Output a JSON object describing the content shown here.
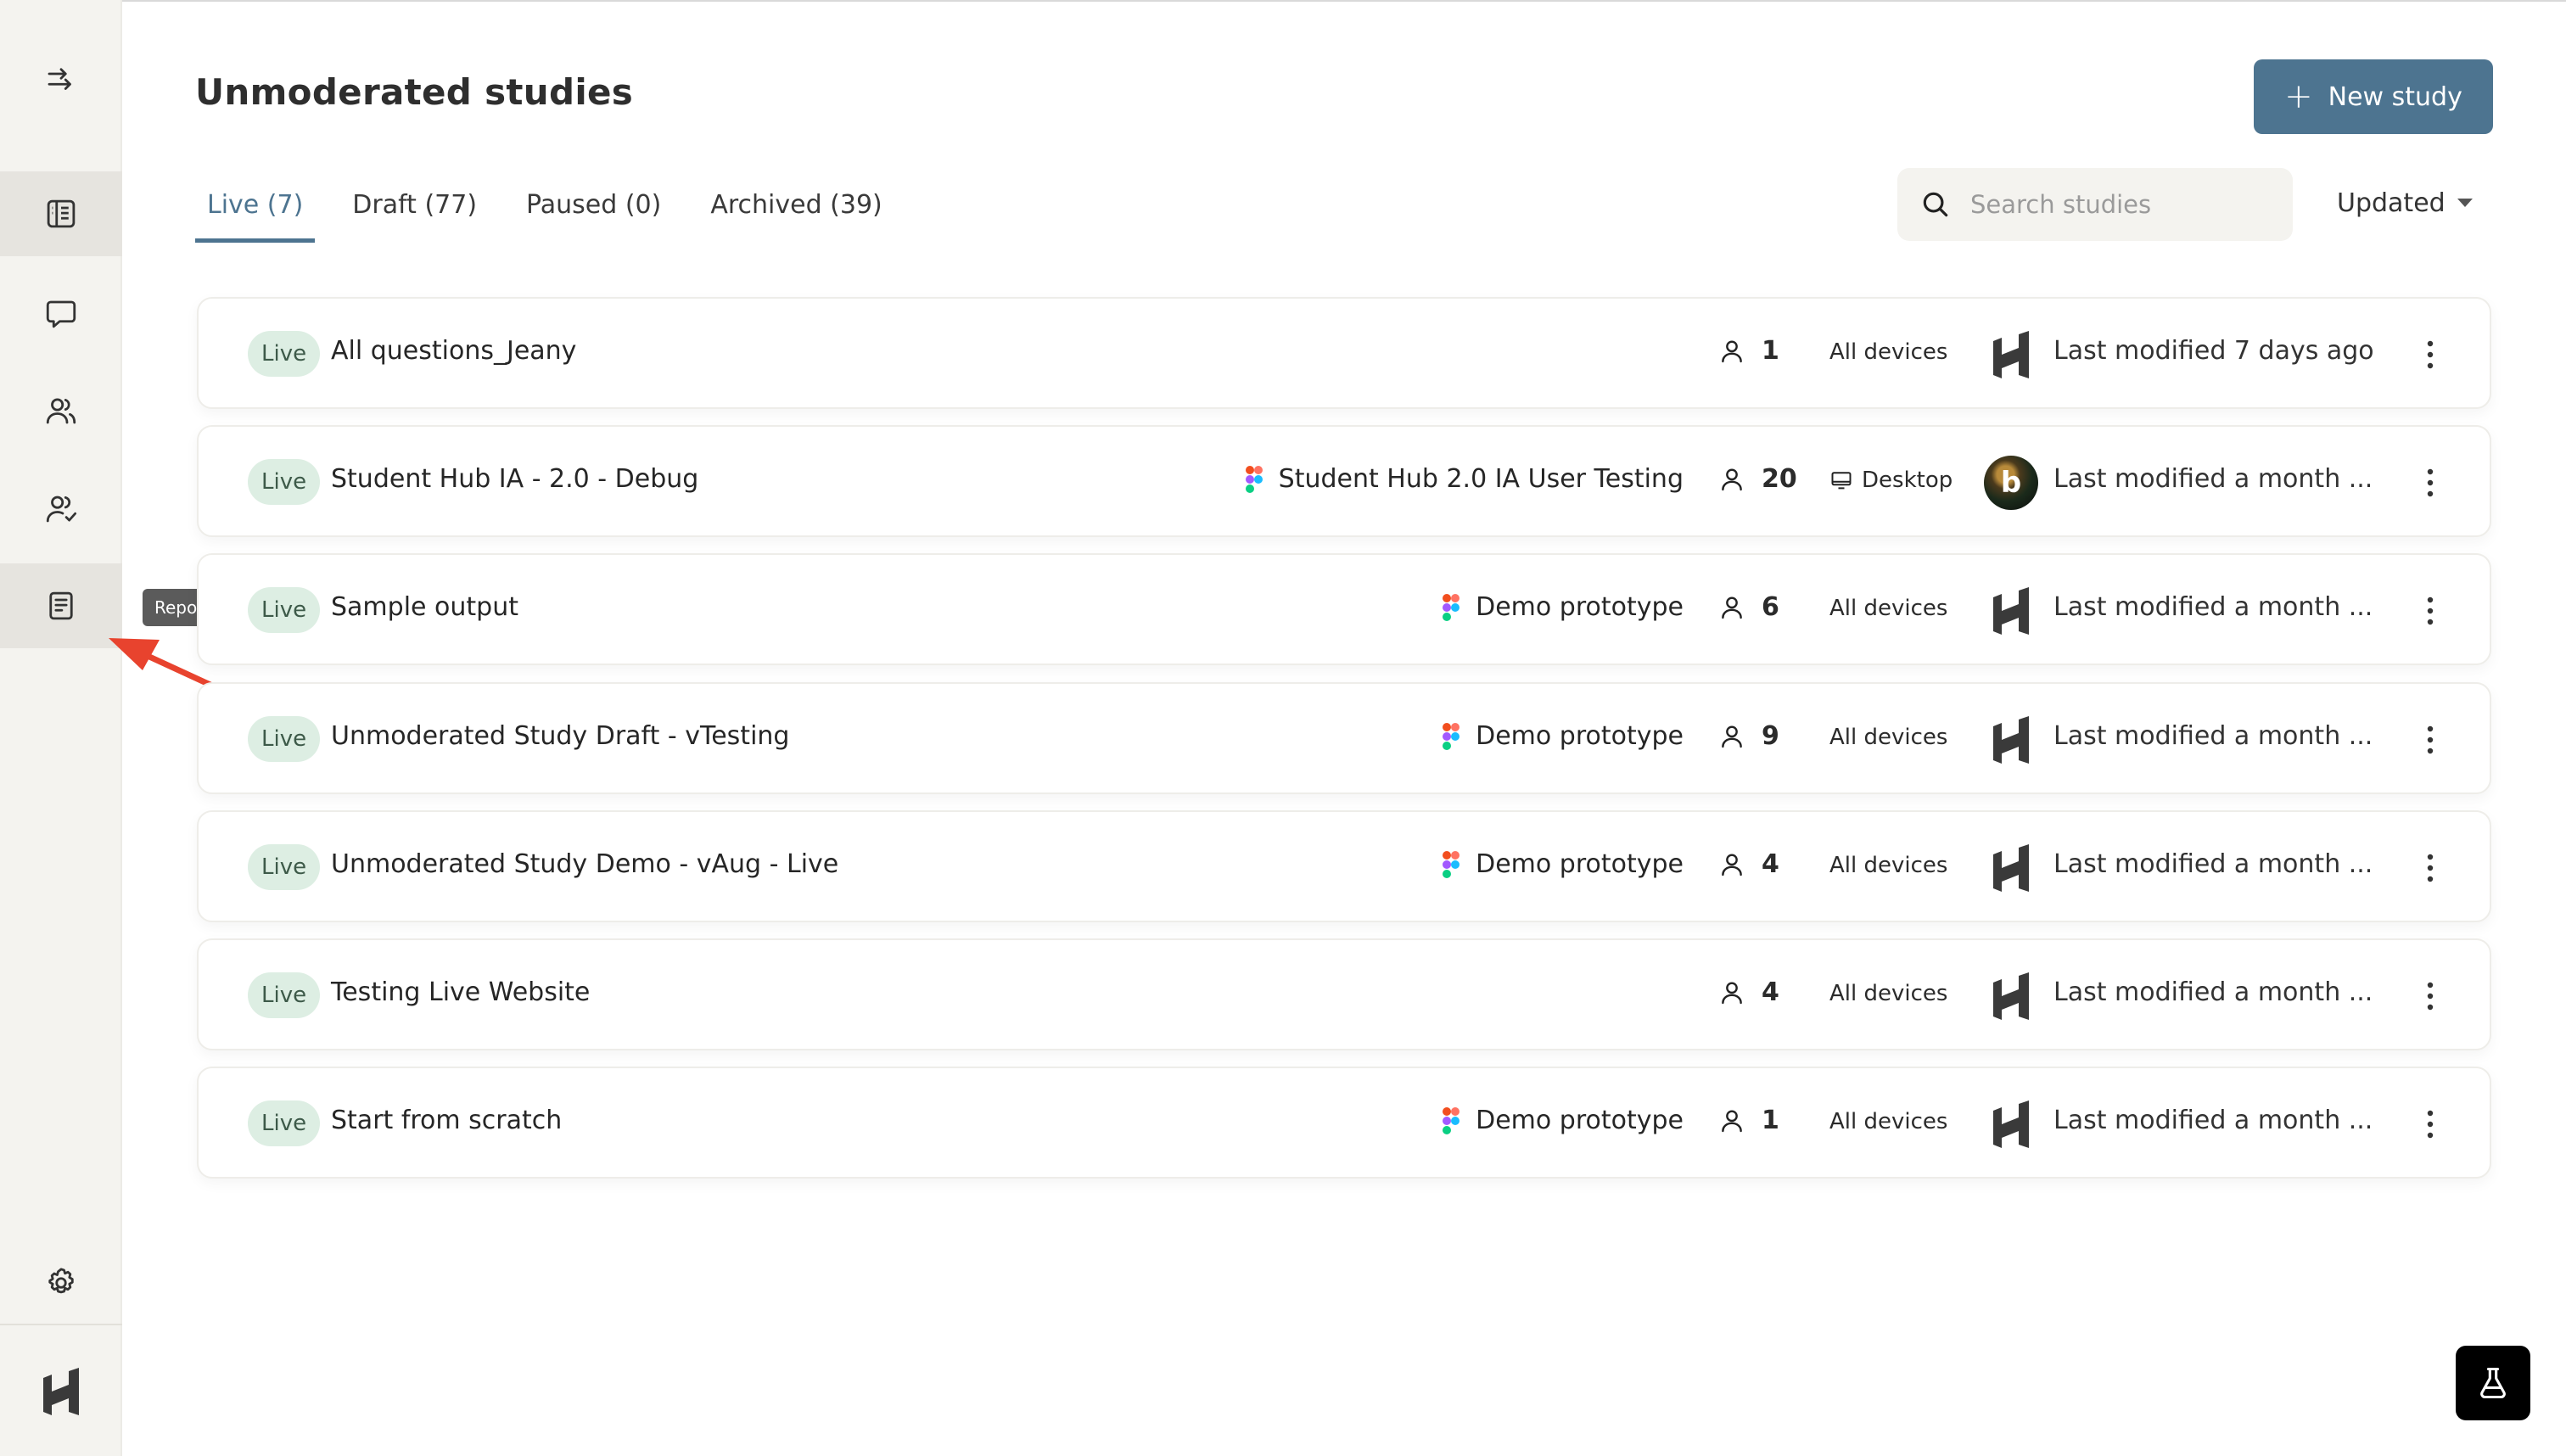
{
  "sidebar": {
    "collapse_icon": "arrow-right-to-line-icon",
    "items": [
      {
        "name": "studies",
        "icon": "book-open-icon",
        "active": true
      },
      {
        "name": "interviews",
        "icon": "chat-bubble-icon",
        "active": false
      },
      {
        "name": "participants",
        "icon": "users-icon",
        "active": false
      },
      {
        "name": "panel",
        "icon": "user-check-icon",
        "active": false
      },
      {
        "name": "reports",
        "icon": "document-icon",
        "active": false
      }
    ],
    "settings_icon": "gear-icon",
    "logo_icon": "brand-logo-icon",
    "tooltip": "Reports"
  },
  "header": {
    "title": "Unmoderated studies",
    "new_study_label": "New study"
  },
  "tabs": [
    {
      "label": "Live (7)",
      "active": true
    },
    {
      "label": "Draft (77)",
      "active": false
    },
    {
      "label": "Paused (0)",
      "active": false
    },
    {
      "label": "Archived (39)",
      "active": false
    }
  ],
  "search": {
    "placeholder": "Search studies",
    "value": ""
  },
  "sort": {
    "label": "Updated"
  },
  "studies": [
    {
      "status": "Live",
      "title": "All questions_Jeany",
      "prototype": "",
      "participants": "1",
      "devices": "All devices",
      "device_icon": "",
      "owner": "brand-logo",
      "modified": "Last modified 7 days ago"
    },
    {
      "status": "Live",
      "title": "Student Hub IA - 2.0 - Debug",
      "prototype": "Student Hub 2.0 IA User Testing",
      "participants": "20",
      "devices": "Desktop",
      "device_icon": "monitor-icon",
      "owner": "user-photo",
      "modified": "Last modified a month ..."
    },
    {
      "status": "Live",
      "title": "Sample output",
      "prototype": "Demo prototype",
      "participants": "6",
      "devices": "All devices",
      "device_icon": "",
      "owner": "brand-logo",
      "modified": "Last modified a month ..."
    },
    {
      "status": "Live",
      "title": "Unmoderated Study Draft - vTesting",
      "prototype": "Demo prototype",
      "participants": "9",
      "devices": "All devices",
      "device_icon": "",
      "owner": "brand-logo",
      "modified": "Last modified a month ..."
    },
    {
      "status": "Live",
      "title": "Unmoderated Study Demo - vAug - Live",
      "prototype": "Demo prototype",
      "participants": "4",
      "devices": "All devices",
      "device_icon": "",
      "owner": "brand-logo",
      "modified": "Last modified a month ..."
    },
    {
      "status": "Live",
      "title": "Testing Live Website",
      "prototype": "",
      "participants": "4",
      "devices": "All devices",
      "device_icon": "",
      "owner": "brand-logo",
      "modified": "Last modified a month ..."
    },
    {
      "status": "Live",
      "title": "Start from scratch",
      "prototype": "Demo prototype",
      "participants": "1",
      "devices": "All devices",
      "device_icon": "",
      "owner": "brand-logo",
      "modified": "Last modified a month ..."
    }
  ],
  "fab_icon": "flask-icon",
  "colors": {
    "accent": "#4d7490",
    "badge_bg": "#ddeee3",
    "sidebar_bg": "#f4f3ef",
    "annotation_arrow": "#e8432e"
  }
}
